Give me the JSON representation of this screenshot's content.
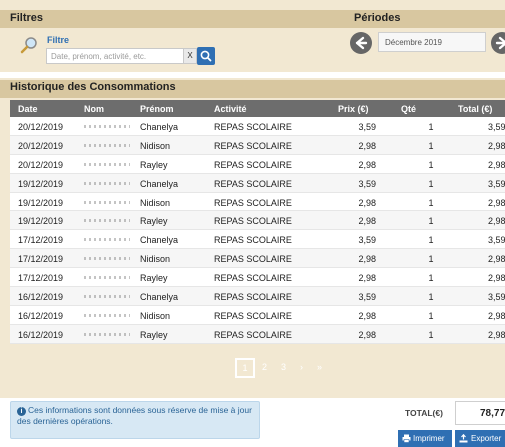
{
  "filters": {
    "title": "Filtres",
    "filter_label": "Filtre",
    "search_placeholder": "Date, prénom, activité, etc.",
    "clear_label": "X"
  },
  "periods": {
    "title": "Périodes",
    "current": "Décembre 2019"
  },
  "history": {
    "title": "Historique des Consommations",
    "columns": [
      "Date",
      "Nom",
      "Prénom",
      "Activité",
      "Prix (€)",
      "Qté",
      "Total (€)"
    ],
    "rows": [
      {
        "date": "20/12/2019",
        "prenom": "Chanelya",
        "activite": "REPAS SCOLAIRE",
        "prix": "3,59",
        "qte": "1",
        "total": "3,59"
      },
      {
        "date": "20/12/2019",
        "prenom": "Nidison",
        "activite": "REPAS SCOLAIRE",
        "prix": "2,98",
        "qte": "1",
        "total": "2,98"
      },
      {
        "date": "20/12/2019",
        "prenom": "Rayley",
        "activite": "REPAS SCOLAIRE",
        "prix": "2,98",
        "qte": "1",
        "total": "2,98"
      },
      {
        "date": "19/12/2019",
        "prenom": "Chanelya",
        "activite": "REPAS SCOLAIRE",
        "prix": "3,59",
        "qte": "1",
        "total": "3,59"
      },
      {
        "date": "19/12/2019",
        "prenom": "Nidison",
        "activite": "REPAS SCOLAIRE",
        "prix": "2,98",
        "qte": "1",
        "total": "2,98"
      },
      {
        "date": "19/12/2019",
        "prenom": "Rayley",
        "activite": "REPAS SCOLAIRE",
        "prix": "2,98",
        "qte": "1",
        "total": "2,98"
      },
      {
        "date": "17/12/2019",
        "prenom": "Chanelya",
        "activite": "REPAS SCOLAIRE",
        "prix": "3,59",
        "qte": "1",
        "total": "3,59"
      },
      {
        "date": "17/12/2019",
        "prenom": "Nidison",
        "activite": "REPAS SCOLAIRE",
        "prix": "2,98",
        "qte": "1",
        "total": "2,98"
      },
      {
        "date": "17/12/2019",
        "prenom": "Rayley",
        "activite": "REPAS SCOLAIRE",
        "prix": "2,98",
        "qte": "1",
        "total": "2,98"
      },
      {
        "date": "16/12/2019",
        "prenom": "Chanelya",
        "activite": "REPAS SCOLAIRE",
        "prix": "3,59",
        "qte": "1",
        "total": "3,59"
      },
      {
        "date": "16/12/2019",
        "prenom": "Nidison",
        "activite": "REPAS SCOLAIRE",
        "prix": "2,98",
        "qte": "1",
        "total": "2,98"
      },
      {
        "date": "16/12/2019",
        "prenom": "Rayley",
        "activite": "REPAS SCOLAIRE",
        "prix": "2,98",
        "qte": "1",
        "total": "2,98"
      }
    ]
  },
  "pagination": {
    "current": "1",
    "pages": [
      "2",
      "3",
      "›",
      "»"
    ]
  },
  "footer": {
    "info_text": "Ces informations sont données sous réserve de mise à jour des dernières opérations.",
    "total_label": "TOTAL(€)",
    "total_value": "78,77",
    "print_label": "Imprimer",
    "export_label": "Exporter"
  },
  "colors": {
    "panel_bg": "#f2e8d2",
    "header_bar": "#d8c7a0",
    "table_header": "#6d6d6d",
    "accent_blue": "#2f6fb3",
    "info_bg": "#d7e8f4"
  },
  "icons": {
    "filter": "search-magnifier-icon",
    "search": "search-icon",
    "prev": "arrow-left-circle-icon",
    "next": "arrow-right-circle-icon",
    "info": "info-icon",
    "print": "printer-icon",
    "export": "export-icon"
  }
}
